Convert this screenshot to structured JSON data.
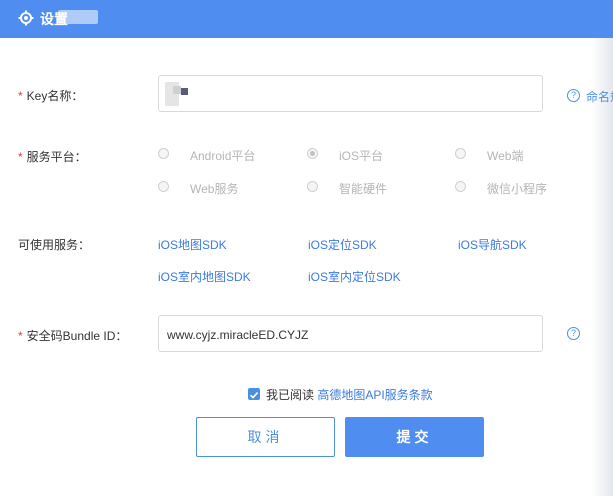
{
  "header": {
    "title": "设置"
  },
  "form": {
    "key_name": {
      "label": "Key名称：",
      "value": "",
      "help_text": "命名规"
    },
    "platform": {
      "label": "服务平台：",
      "options": [
        "Android平台",
        "iOS平台",
        "Web端",
        "Web服务",
        "智能硬件",
        "微信小程序"
      ],
      "selected": "iOS平台"
    },
    "services": {
      "label": "可使用服务：",
      "items": [
        "iOS地图SDK",
        "iOS定位SDK",
        "iOS导航SDK",
        "iOS室内地图SDK",
        "iOS室内定位SDK"
      ]
    },
    "bundle_id": {
      "label": "安全码Bundle ID：",
      "value": "www.cyjz.miracleED.CYJZ"
    },
    "required_mark": "*"
  },
  "agreement": {
    "checked": true,
    "prefix": "我已阅读 ",
    "link": "高德地图API服务条款"
  },
  "buttons": {
    "cancel": "取消",
    "submit": "提交"
  },
  "colors": {
    "accent": "#4f8ef0",
    "required": "#e0393e",
    "link": "#3b7be0"
  }
}
